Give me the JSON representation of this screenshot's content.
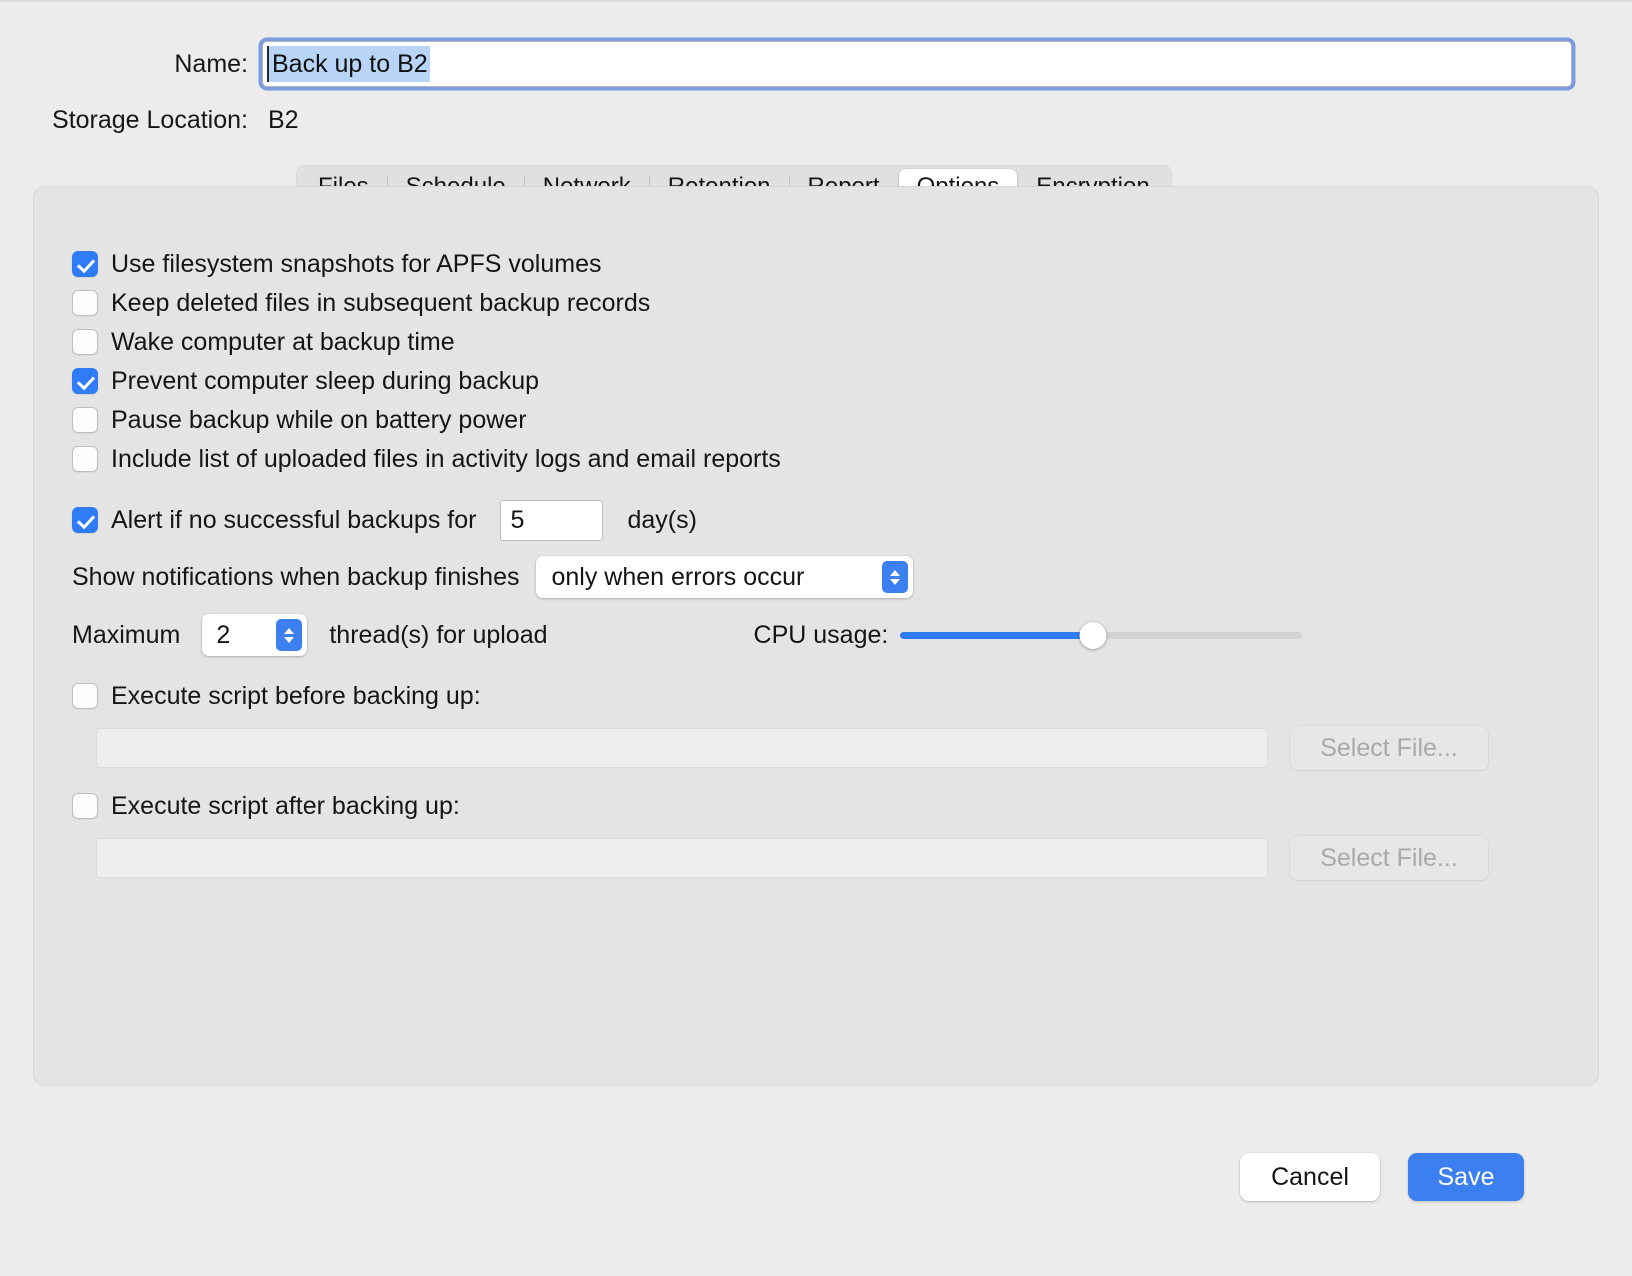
{
  "header": {
    "name_label": "Name:",
    "name_value": "Back up to B2",
    "storage_label": "Storage Location:",
    "storage_value": "B2"
  },
  "tabs": [
    {
      "label": "Files",
      "selected": false
    },
    {
      "label": "Schedule",
      "selected": false
    },
    {
      "label": "Network",
      "selected": false
    },
    {
      "label": "Retention",
      "selected": false
    },
    {
      "label": "Report",
      "selected": false
    },
    {
      "label": "Options",
      "selected": true
    },
    {
      "label": "Encryption",
      "selected": false
    }
  ],
  "options": {
    "checkboxes": [
      {
        "label": "Use filesystem snapshots for APFS volumes",
        "checked": true
      },
      {
        "label": "Keep deleted files in subsequent backup records",
        "checked": false
      },
      {
        "label": "Wake computer at backup time",
        "checked": false
      },
      {
        "label": "Prevent computer sleep during backup",
        "checked": true
      },
      {
        "label": "Pause backup while on battery power",
        "checked": false
      },
      {
        "label": "Include list of uploaded files in activity logs and email reports",
        "checked": false
      }
    ],
    "alert": {
      "label": "Alert if no successful backups for",
      "checked": true,
      "days_value": "5",
      "unit_label": "day(s)"
    },
    "notifications": {
      "label": "Show notifications when backup finishes",
      "selected_option": "only when errors occur"
    },
    "threads": {
      "prefix_label": "Maximum",
      "value": "2",
      "suffix_label": "thread(s) for upload"
    },
    "cpu": {
      "label": "CPU usage:",
      "percent": 48
    },
    "script_before": {
      "label": "Execute script before backing up:",
      "checked": false,
      "path_value": "",
      "button_label": "Select File..."
    },
    "script_after": {
      "label": "Execute script after backing up:",
      "checked": false,
      "path_value": "",
      "button_label": "Select File..."
    }
  },
  "footer": {
    "cancel_label": "Cancel",
    "save_label": "Save"
  },
  "colors": {
    "accent": "#2f7cf6",
    "window_bg": "#ececec",
    "panel_bg": "#e4e4e4"
  }
}
